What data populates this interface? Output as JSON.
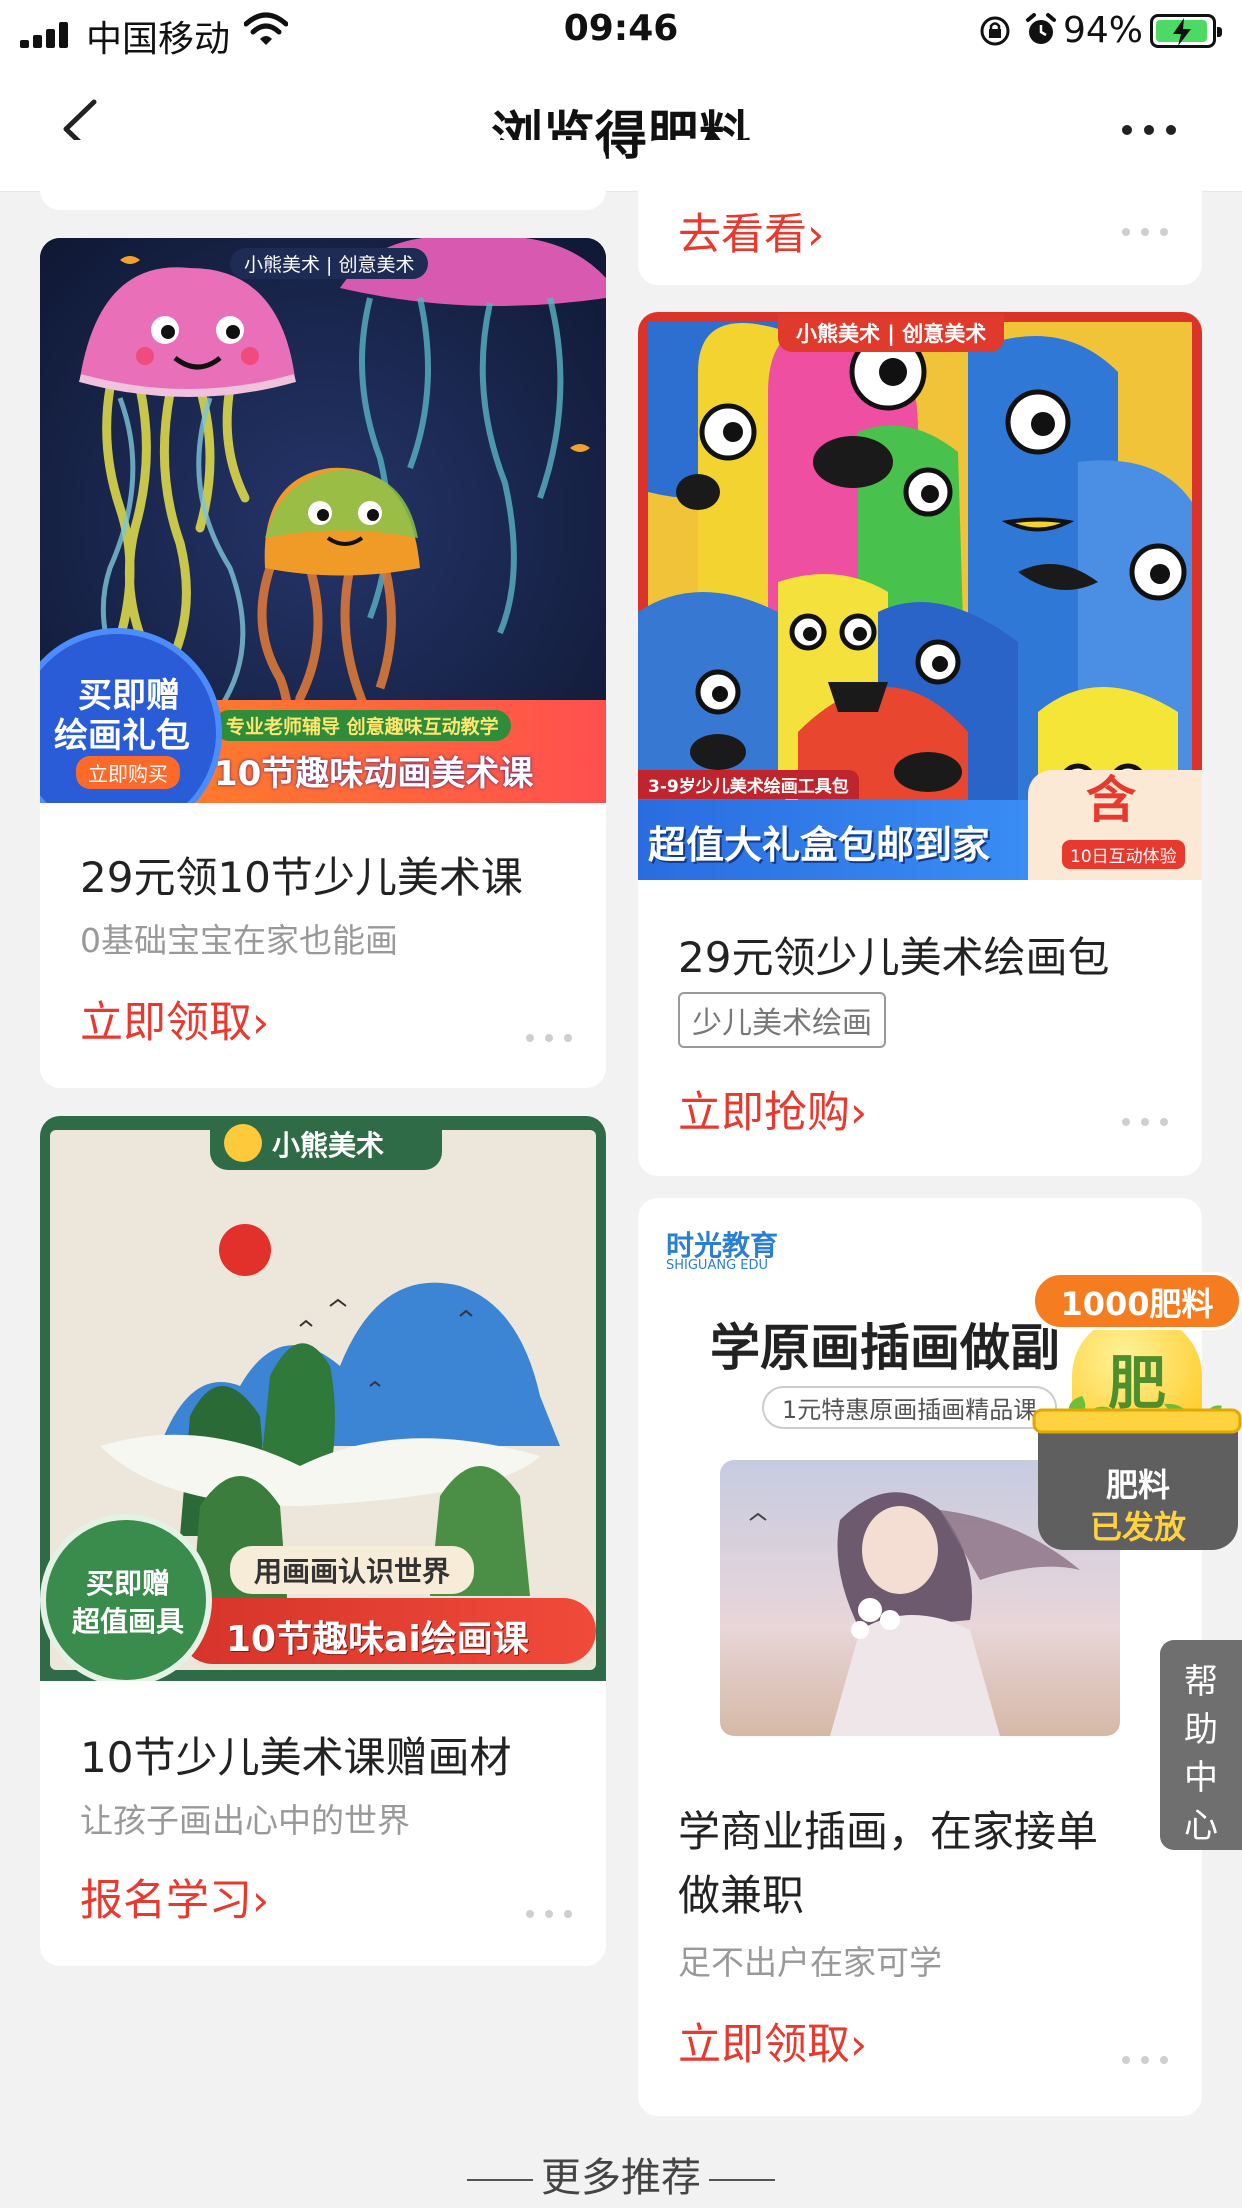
{
  "status_bar": {
    "carrier": "中国移动",
    "time": "09:46",
    "battery_percent": "94%",
    "battery_level": 0.94,
    "icons": [
      "signal-icon",
      "wifi-icon",
      "lock-rotation-icon",
      "alarm-icon",
      "battery-charging-icon"
    ]
  },
  "nav": {
    "title": "浏览得肥料",
    "back_icon": "chevron-left-icon",
    "more_icon": "more-icon"
  },
  "top_partial": {
    "cta": "去看看›"
  },
  "cards": [
    {
      "brand": "小熊美术 | 创意美术",
      "badge_line1": "买即赠",
      "badge_line2": "绘画礼包",
      "badge_button": "立即购买",
      "ribbon_small": "专业老师辅导 创意趣味互动教学",
      "ribbon_big": "10节趣味动画美术课",
      "title": "29元领10节少儿美术课",
      "subtitle": "0基础宝宝在家也能画",
      "cta": "立即领取›"
    },
    {
      "brand": "小熊美术 | 创意美术",
      "age_label": "3-9岁少儿美术绘画工具包",
      "banner": "超值大礼盒包邮到家",
      "side_label": "10日互动体验",
      "title": "29元领少儿美术绘画包",
      "tag": "少儿美术绘画",
      "cta": "立即抢购›"
    },
    {
      "brand": "小熊美术",
      "badge_line1": "买即赠",
      "badge_line2": "超值画具",
      "ribbon_small": "用画画认识世界",
      "ribbon_big": "10节趣味ai绘画课",
      "title": "10节少儿美术课赠画材",
      "subtitle": "让孩子画出心中的世界",
      "cta": "报名学习›"
    },
    {
      "brand": "时光教育",
      "brand_en": "SHIGUANG EDU",
      "headline": "学原画插画做副",
      "subline": "1元特惠原画插画精品课",
      "title_line1": "学商业插画，在家接单",
      "title_line2": "做兼职",
      "subtitle": "足不出户在家可学",
      "cta": "立即领取›"
    }
  ],
  "reward": {
    "amount": "1000肥料",
    "pot_char": "肥",
    "line1": "肥料",
    "line2": "已发放"
  },
  "help": {
    "label": "帮助中心"
  },
  "footer": {
    "label": "更多推荐"
  },
  "colors": {
    "accent": "#e8392f",
    "background": "#f2f2f2",
    "reward_orange": "#f57c1f",
    "reward_yellow": "#ffd23f"
  }
}
